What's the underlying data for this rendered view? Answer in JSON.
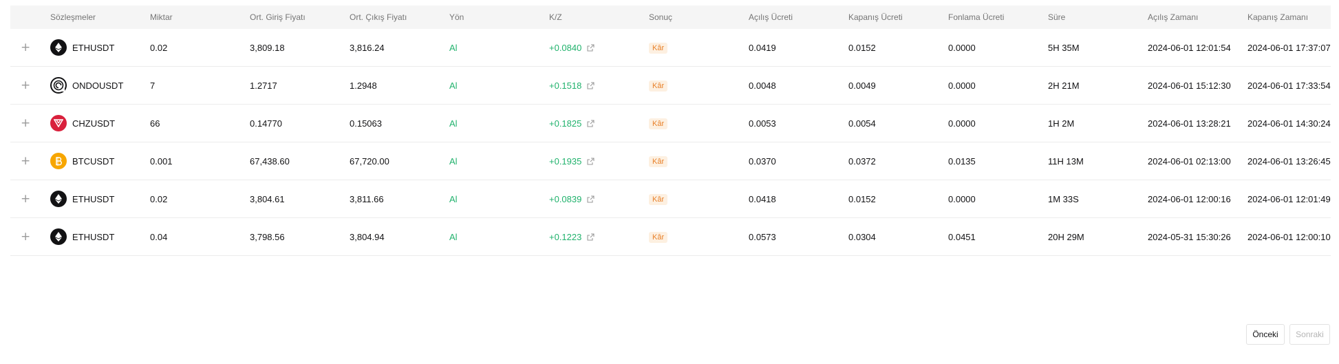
{
  "table": {
    "headers": [
      "",
      "Sözleşmeler",
      "Miktar",
      "Ort. Giriş Fiyatı",
      "Ort. Çıkış Fiyatı",
      "Yön",
      "K/Z",
      "Sonuç",
      "Açılış Ücreti",
      "Kapanış Ücreti",
      "Fonlama Ücreti",
      "Süre",
      "Açılış Zamanı",
      "Kapanış Zamanı"
    ],
    "expand_symbol": "+",
    "rows": [
      {
        "icon": "eth-icon",
        "symbol": "ETHUSDT",
        "qty": "0.02",
        "entry": "3,809.18",
        "exit": "3,816.24",
        "side": "Al",
        "pnl": "+0.0840",
        "result": "Kâr",
        "open_fee": "0.0419",
        "close_fee": "0.0152",
        "funding_fee": "0.0000",
        "duration": "5H 35M",
        "open_time": "2024-06-01 12:01:54",
        "close_time": "2024-06-01 17:37:07"
      },
      {
        "icon": "ondo-icon",
        "symbol": "ONDOUSDT",
        "qty": "7",
        "entry": "1.2717",
        "exit": "1.2948",
        "side": "Al",
        "pnl": "+0.1518",
        "result": "Kâr",
        "open_fee": "0.0048",
        "close_fee": "0.0049",
        "funding_fee": "0.0000",
        "duration": "2H 21M",
        "open_time": "2024-06-01 15:12:30",
        "close_time": "2024-06-01 17:33:54"
      },
      {
        "icon": "chz-icon",
        "symbol": "CHZUSDT",
        "qty": "66",
        "entry": "0.14770",
        "exit": "0.15063",
        "side": "Al",
        "pnl": "+0.1825",
        "result": "Kâr",
        "open_fee": "0.0053",
        "close_fee": "0.0054",
        "funding_fee": "0.0000",
        "duration": "1H 2M",
        "open_time": "2024-06-01 13:28:21",
        "close_time": "2024-06-01 14:30:24"
      },
      {
        "icon": "btc-icon",
        "symbol": "BTCUSDT",
        "qty": "0.001",
        "entry": "67,438.60",
        "exit": "67,720.00",
        "side": "Al",
        "pnl": "+0.1935",
        "result": "Kâr",
        "open_fee": "0.0370",
        "close_fee": "0.0372",
        "funding_fee": "0.0135",
        "duration": "11H 13M",
        "open_time": "2024-06-01 02:13:00",
        "close_time": "2024-06-01 13:26:45"
      },
      {
        "icon": "eth-icon",
        "symbol": "ETHUSDT",
        "qty": "0.02",
        "entry": "3,804.61",
        "exit": "3,811.66",
        "side": "Al",
        "pnl": "+0.0839",
        "result": "Kâr",
        "open_fee": "0.0418",
        "close_fee": "0.0152",
        "funding_fee": "0.0000",
        "duration": "1M 33S",
        "open_time": "2024-06-01 12:00:16",
        "close_time": "2024-06-01 12:01:49"
      },
      {
        "icon": "eth-icon",
        "symbol": "ETHUSDT",
        "qty": "0.04",
        "entry": "3,798.56",
        "exit": "3,804.94",
        "side": "Al",
        "pnl": "+0.1223",
        "result": "Kâr",
        "open_fee": "0.0573",
        "close_fee": "0.0304",
        "funding_fee": "0.0451",
        "duration": "20H 29M",
        "open_time": "2024-05-31 15:30:26",
        "close_time": "2024-06-01 12:00:10"
      }
    ]
  },
  "pagination": {
    "prev_label": "Önceki",
    "next_label": "Sonraki"
  },
  "colors": {
    "profit_green": "#20b26c",
    "badge_bg": "#fdf0e1",
    "badge_text": "#e8812b",
    "header_bg": "#f5f5f5"
  }
}
